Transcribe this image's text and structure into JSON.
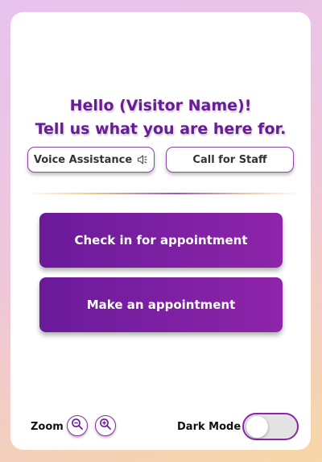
{
  "colors": {
    "accent": "#6a1b9a",
    "accent_light": "#8e24aa",
    "card_bg": "#ffffff",
    "toggle_off": "#e3e3e3"
  },
  "header": {
    "greeting": "Hello (Visitor Name)!",
    "prompt": "Tell us what you are here for."
  },
  "quick_actions": {
    "voice_label": "Voice Assistance",
    "voice_icon": "speaker-icon",
    "staff_label": "Call for Staff"
  },
  "main": {
    "check_in_label": "Check in for appointment",
    "make_appointment_label": "Make an appointment"
  },
  "footer": {
    "zoom_label": "Zoom",
    "zoom_out_icon": "zoom-out-icon",
    "zoom_in_icon": "zoom-in-icon",
    "dark_mode_label": "Dark Mode",
    "dark_mode_on": false
  }
}
